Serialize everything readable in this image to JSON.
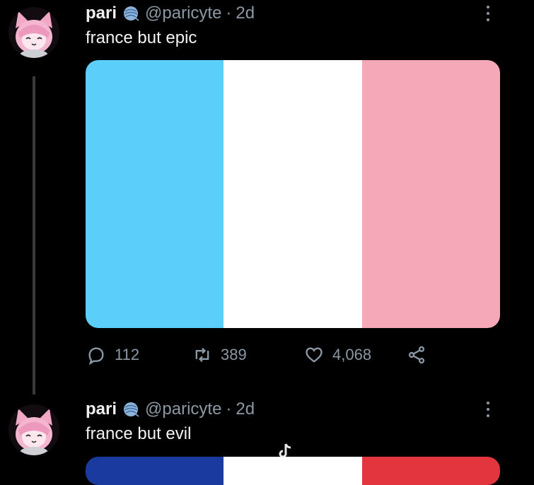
{
  "colors": {
    "background": "#000000",
    "trans_blue": "#5bcefa",
    "trans_white": "#ffffff",
    "trans_pink": "#f5a9b8",
    "france_blue": "#1b3aa0",
    "france_white": "#ffffff",
    "france_red": "#e3353d",
    "muted": "#8b98a5"
  },
  "tweets": [
    {
      "name": "pari",
      "badge_icon": "yarn-ball-icon",
      "handle": "@paricyte",
      "dot": "·",
      "time": "2d",
      "text": "france but epic",
      "media": "flag with light blue, white and pink vertical stripes",
      "stats": {
        "replies": "112",
        "retweets": "389",
        "likes": "4,068"
      }
    },
    {
      "name": "pari",
      "badge_icon": "yarn-ball-icon",
      "handle": "@paricyte",
      "dot": "·",
      "time": "2d",
      "text": "france but evil",
      "media": "flag with blue, white and red vertical stripes (cropped)"
    }
  ],
  "watermark": "TikTok watermark"
}
